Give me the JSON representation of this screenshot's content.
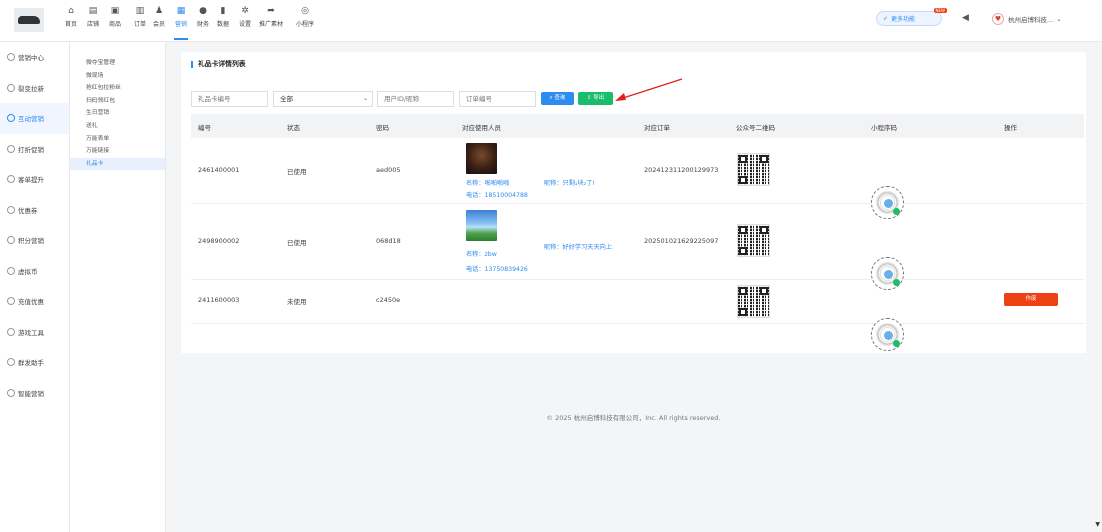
{
  "header": {
    "nav": [
      {
        "label": "首页",
        "icon": "home-icon",
        "glyph": "⌂"
      },
      {
        "label": "店铺",
        "icon": "store-icon",
        "glyph": "▤"
      },
      {
        "label": "商品",
        "icon": "goods-icon",
        "glyph": "▣"
      },
      {
        "label": "订单",
        "icon": "order-icon",
        "glyph": "▥"
      },
      {
        "label": "会员",
        "icon": "member-icon",
        "glyph": "♟"
      },
      {
        "label": "营销",
        "icon": "marketing-icon",
        "glyph": "▦",
        "active": true
      },
      {
        "label": "财务",
        "icon": "finance-icon",
        "glyph": "●"
      },
      {
        "label": "数据",
        "icon": "data-icon",
        "glyph": "▮"
      },
      {
        "label": "设置",
        "icon": "settings-icon",
        "glyph": "✲"
      },
      {
        "label": "推广素材",
        "icon": "share-icon",
        "glyph": "➦"
      },
      {
        "label": "小程序",
        "icon": "miniprogram-icon",
        "glyph": "◎"
      }
    ],
    "more_label": "更多功能",
    "more_badge": "NEW",
    "company": "杭州启博科技..."
  },
  "sidebar": {
    "items": [
      {
        "label": "营销中心"
      },
      {
        "label": "裂变拉新"
      },
      {
        "label": "互动营销",
        "active": true
      },
      {
        "label": "打折促销"
      },
      {
        "label": "客单提升"
      },
      {
        "label": "优惠券"
      },
      {
        "label": "积分营销"
      },
      {
        "label": "虚拟币"
      },
      {
        "label": "充值优惠"
      },
      {
        "label": "游戏工具"
      },
      {
        "label": "群发助手"
      },
      {
        "label": "智能营销"
      }
    ],
    "subitems": [
      {
        "label": "微夺宝管理"
      },
      {
        "label": "微现场"
      },
      {
        "label": "抢红包拉粉丝"
      },
      {
        "label": "扫码领红包"
      },
      {
        "label": "生日营销"
      },
      {
        "label": "送礼"
      },
      {
        "label": "万能表单"
      },
      {
        "label": "万能链接"
      },
      {
        "label": "礼品卡",
        "active": true
      }
    ]
  },
  "main": {
    "title": "礼品卡详情列表",
    "filters": {
      "card_no_placeholder": "礼品卡编号",
      "status_value": "全部",
      "user_placeholder": "用户ID/昵称",
      "order_placeholder": "订单编号",
      "search_label": "查询",
      "export_label": "导出"
    },
    "columns": [
      "编号",
      "状态",
      "密码",
      "对应使用人员",
      "对应订单",
      "公众号二维码",
      "小程序码",
      "操作"
    ],
    "rows": [
      {
        "id": "2461400001",
        "status": "已使用",
        "password": "aed005",
        "user_name": "名称：啪啪啪啪",
        "user_nick": "昵称：只剩‪₁块₂了!",
        "user_phone": "电话：18510004788",
        "order": "202412311200129973"
      },
      {
        "id": "2498900002",
        "status": "已使用",
        "password": "068d18",
        "user_name": "名称：zbw",
        "user_nick": "昵称：好好学习天天向上",
        "user_phone": "电话：13750839426",
        "order": "202501021629225097"
      },
      {
        "id": "2411600003",
        "status": "未使用",
        "password": "c2450e",
        "user_name": "",
        "user_nick": "",
        "user_phone": "",
        "order": "",
        "action": "作废"
      }
    ]
  },
  "footer": "© 2025 杭州启博科技有限公司，Inc. All rights reserved."
}
